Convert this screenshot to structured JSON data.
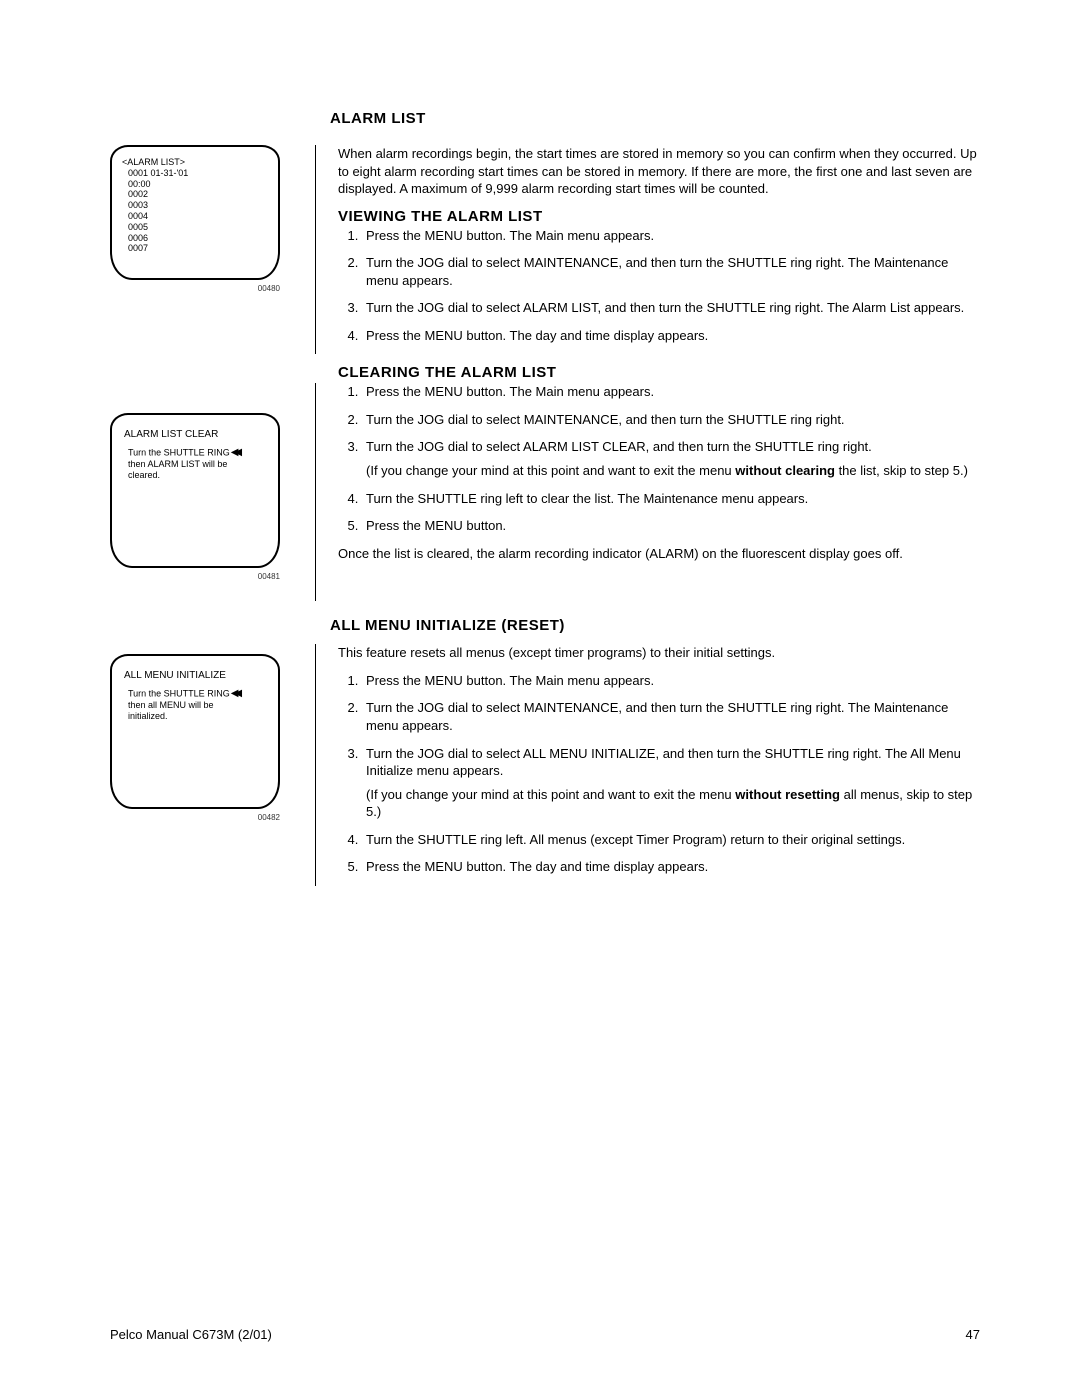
{
  "title_alarm_list": "Alarm List",
  "intro_para": "When alarm recordings begin, the start times are stored in memory so you can confirm when they occurred. Up to eight alarm recording start times can be stored in memory. If there are more, the first one and last seven are displayed. A maximum of 9,999 alarm recording start times will be counted.",
  "screen1": {
    "header": "<ALARM LIST>",
    "rows": [
      "0001    01-31-'01",
      "00:00",
      "0002",
      "0003",
      "0004",
      "0005",
      "0006",
      "0007"
    ],
    "caption": "00480"
  },
  "viewing_title": "Viewing the Alarm List",
  "viewing_steps": [
    "Press the MENU button. The Main menu appears.",
    "Turn the JOG dial to select MAINTENANCE, and then turn the SHUTTLE ring right. The Maintenance menu appears.",
    "Turn the JOG dial to select ALARM LIST, and then turn the SHUTTLE ring right. The Alarm List appears.",
    "Press the MENU button. The day and time display appears."
  ],
  "clearing_title": "Clearing the Alarm List",
  "clearing_steps_a": [
    "Press the MENU button. The Main menu appears.",
    "Turn the JOG dial to select MAINTENANCE, and then turn the SHUTTLE ring right.",
    "Turn the JOG dial to select ALARM LIST CLEAR, and then turn the SHUTTLE ring right."
  ],
  "clearing_note_pre": "(If you change your mind at this point and want to exit the menu ",
  "clearing_note_bold": "without clearing",
  "clearing_note_post": " the list, skip to step 5.)",
  "clearing_steps_b": [
    "Turn the SHUTTLE ring left to clear the list. The Maintenance menu appears.",
    "Press the MENU button."
  ],
  "clearing_para": "Once the list is cleared, the alarm recording indicator (ALARM) on the fluorescent display goes off.",
  "screen2": {
    "title": "ALARM LIST CLEAR",
    "line1": "Turn the SHUTTLE RING",
    "line2": "then ALARM LIST will be",
    "line3": "cleared.",
    "caption": "00481"
  },
  "all_menu_title": "All Menu Initialize (Reset)",
  "all_menu_intro": "This feature resets all menus (except timer programs) to their initial settings.",
  "all_menu_steps_a": [
    "Press the MENU button. The Main menu appears.",
    "Turn the JOG dial to select MAINTENANCE, and then turn the SHUTTLE ring right. The Maintenance menu appears.",
    "Turn the JOG dial to select ALL MENU INITIALIZE, and then turn the SHUTTLE ring right. The All Menu Initialize menu appears."
  ],
  "all_menu_note_pre": "(If you change your mind at this point and want to exit the menu ",
  "all_menu_note_bold": "without resetting",
  "all_menu_note_post": " all menus, skip to step 5.)",
  "all_menu_steps_b": [
    "Turn the SHUTTLE ring left. All menus (except Timer Program) return to their original settings.",
    "Press the MENU button. The day and time display appears."
  ],
  "screen3": {
    "title": "ALL MENU INITIALIZE",
    "line1": "Turn the SHUTTLE RING",
    "line2": "then all MENU will be",
    "line3": "initialized.",
    "caption": "00482"
  },
  "footer_left": "Pelco Manual C673M (2/01)",
  "footer_right": "47"
}
